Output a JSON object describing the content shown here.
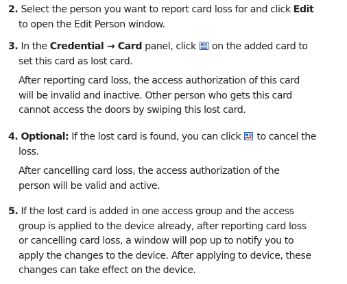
{
  "steps": [
    {
      "number": "2.",
      "lines": [
        {
          "segments": [
            {
              "text": "Select the person you want to report card loss for and click ",
              "bold": false
            },
            {
              "text": "Edit",
              "bold": true
            }
          ]
        },
        {
          "indent": true,
          "segments": [
            {
              "text": "to open the Edit Person window.",
              "bold": false
            }
          ]
        }
      ]
    },
    {
      "number": "3.",
      "lines": [
        {
          "segments": [
            {
              "text": "In the ",
              "bold": false
            },
            {
              "text": "Credential → Card",
              "bold": true
            },
            {
              "text": " panel, click ",
              "bold": false
            },
            {
              "icon": "report-card-loss-icon"
            },
            {
              "text": " on the added card to",
              "bold": false
            }
          ]
        },
        {
          "indent": true,
          "segments": [
            {
              "text": "set this card as lost card.",
              "bold": false
            }
          ]
        },
        {
          "gap": true
        },
        {
          "indent": true,
          "segments": [
            {
              "text": "After reporting card loss, the access authorization of this card",
              "bold": false
            }
          ]
        },
        {
          "indent": true,
          "segments": [
            {
              "text": "will be invalid and inactive. Other person who gets this card",
              "bold": false
            }
          ]
        },
        {
          "indent": true,
          "segments": [
            {
              "text": "cannot access the doors by swiping this lost card.",
              "bold": false
            }
          ]
        }
      ]
    },
    {
      "number": "4.",
      "lines": [
        {
          "segments": [
            {
              "text": "Optional:",
              "bold": true
            },
            {
              "text": " If the lost card is found, you can click ",
              "bold": false
            },
            {
              "icon": "cancel-card-loss-icon"
            },
            {
              "text": " to cancel the",
              "bold": false
            }
          ]
        },
        {
          "indent": true,
          "segments": [
            {
              "text": "loss.",
              "bold": false
            }
          ]
        },
        {
          "gap": true
        },
        {
          "indent": true,
          "segments": [
            {
              "text": "After cancelling card loss, the access authorization of the",
              "bold": false
            }
          ]
        },
        {
          "indent": true,
          "segments": [
            {
              "text": "person will be valid and active.",
              "bold": false
            }
          ]
        }
      ]
    },
    {
      "number": "5.",
      "lines": [
        {
          "segments": [
            {
              "text": "If the lost card is added in one access group and the access",
              "bold": false
            }
          ]
        },
        {
          "indent": true,
          "segments": [
            {
              "text": "group is applied to the device already, after reporting card loss",
              "bold": false
            }
          ]
        },
        {
          "indent": true,
          "segments": [
            {
              "text": "or cancelling card loss, a window will pop up to notify you to",
              "bold": false
            }
          ]
        },
        {
          "indent": true,
          "segments": [
            {
              "text": "apply the changes to the device. After applying to device, these",
              "bold": false
            }
          ]
        },
        {
          "indent": true,
          "segments": [
            {
              "text": "changes can take effect on the device.",
              "bold": false
            }
          ]
        }
      ]
    }
  ]
}
